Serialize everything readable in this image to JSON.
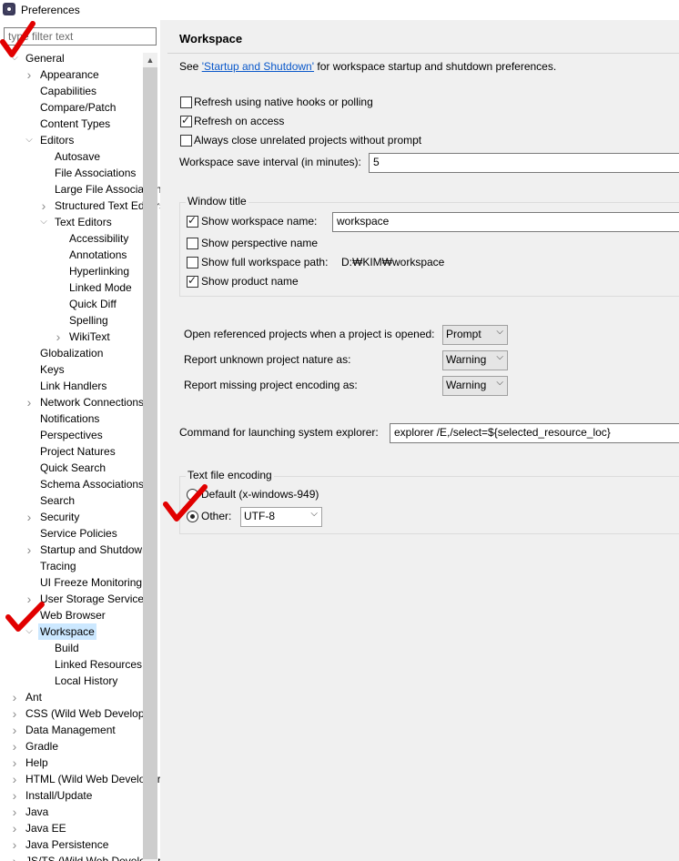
{
  "window": {
    "title": "Preferences"
  },
  "filter": {
    "placeholder": "type filter text"
  },
  "tree": [
    {
      "label": "General"
    },
    {
      "label": "Appearance"
    },
    {
      "label": "Capabilities"
    },
    {
      "label": "Compare/Patch"
    },
    {
      "label": "Content Types"
    },
    {
      "label": "Editors"
    },
    {
      "label": "Autosave"
    },
    {
      "label": "File Associations"
    },
    {
      "label": "Large File Associations"
    },
    {
      "label": "Structured Text Editors"
    },
    {
      "label": "Text Editors"
    },
    {
      "label": "Accessibility"
    },
    {
      "label": "Annotations"
    },
    {
      "label": "Hyperlinking"
    },
    {
      "label": "Linked Mode"
    },
    {
      "label": "Quick Diff"
    },
    {
      "label": "Spelling"
    },
    {
      "label": "WikiText"
    },
    {
      "label": "Globalization"
    },
    {
      "label": "Keys"
    },
    {
      "label": "Link Handlers"
    },
    {
      "label": "Network Connections"
    },
    {
      "label": "Notifications"
    },
    {
      "label": "Perspectives"
    },
    {
      "label": "Project Natures"
    },
    {
      "label": "Quick Search"
    },
    {
      "label": "Schema Associations"
    },
    {
      "label": "Search"
    },
    {
      "label": "Security"
    },
    {
      "label": "Service Policies"
    },
    {
      "label": "Startup and Shutdown"
    },
    {
      "label": "Tracing"
    },
    {
      "label": "UI Freeze Monitoring"
    },
    {
      "label": "User Storage Service"
    },
    {
      "label": "Web Browser"
    },
    {
      "label": "Workspace"
    },
    {
      "label": "Build"
    },
    {
      "label": "Linked Resources"
    },
    {
      "label": "Local History"
    },
    {
      "label": "Ant"
    },
    {
      "label": "CSS (Wild Web Developer)"
    },
    {
      "label": "Data Management"
    },
    {
      "label": "Gradle"
    },
    {
      "label": "Help"
    },
    {
      "label": "HTML (Wild Web Developer)"
    },
    {
      "label": "Install/Update"
    },
    {
      "label": "Java"
    },
    {
      "label": "Java EE"
    },
    {
      "label": "Java Persistence"
    },
    {
      "label": "JS/TS (Wild Web Developer)"
    }
  ],
  "page": {
    "title": "Workspace",
    "see_prefix": "See ",
    "see_link": "'Startup and Shutdown'",
    "see_suffix": " for workspace startup and shutdown preferences.",
    "refresh_native": "Refresh using native hooks or polling",
    "refresh_access": "Refresh on access",
    "always_close": "Always close unrelated projects without prompt",
    "save_interval_label": "Workspace save interval (in minutes):",
    "save_interval_value": "5",
    "window_title": {
      "group_label": "Window title",
      "show_name": "Show workspace name:",
      "name_value": "workspace",
      "show_perspective": "Show perspective name",
      "show_full_path": "Show full workspace path:",
      "path_value": "D:₩KIM₩workspace",
      "show_product": "Show product name"
    },
    "open_referenced_label": "Open referenced projects when a project is opened:",
    "open_referenced_value": "Prompt",
    "unknown_nature_label": "Report unknown project nature as:",
    "unknown_nature_value": "Warning",
    "missing_encoding_label": "Report missing project encoding as:",
    "missing_encoding_value": "Warning",
    "explorer_label": "Command for launching system explorer:",
    "explorer_value": "explorer /E,/select=${selected_resource_loc}",
    "encoding": {
      "group_label": "Text file encoding",
      "default_label": "Default (x-windows-949)",
      "other_label": "Other:",
      "other_value": "UTF-8"
    }
  }
}
